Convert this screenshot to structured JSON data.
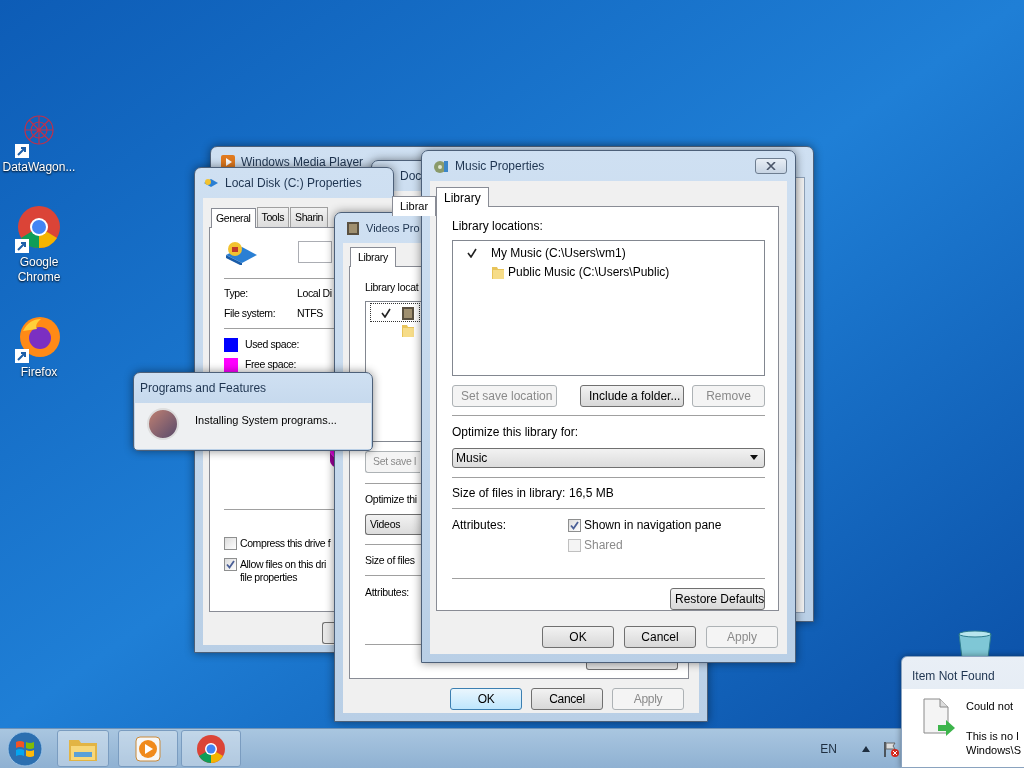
{
  "desktop_icons": [
    {
      "label": "DataWagon...",
      "kind": "datawagon"
    },
    {
      "label": "Google Chrome",
      "kind": "chrome"
    },
    {
      "label": "Firefox",
      "kind": "firefox"
    }
  ],
  "media_player_window": {
    "title": "Windows Media Player"
  },
  "documents_window": {
    "title": "Doc",
    "tabs": [
      {
        "label": "Librar",
        "selected": true
      }
    ]
  },
  "local_disk_window": {
    "title": "Local Disk (C:) Properties",
    "tabs": [
      {
        "label": "General",
        "selected": true
      },
      {
        "label": "Tools",
        "selected": false
      },
      {
        "label": "Sharin",
        "selected": false
      }
    ],
    "info": [
      {
        "label": "Type:",
        "value": "Local Di"
      },
      {
        "label": "File system:",
        "value": "NTFS"
      }
    ],
    "legend": [
      {
        "label": "Used space:",
        "color": "#0000ff"
      },
      {
        "label": "Free space:",
        "color": "#ff00ff"
      }
    ],
    "options": [
      {
        "lines": [
          "Compress this drive f"
        ],
        "checked": false
      },
      {
        "lines": [
          "Allow files on this dri",
          "file properties"
        ],
        "checked": true
      }
    ]
  },
  "programs_dialog": {
    "title": "Programs and Features",
    "message": "Installing System programs..."
  },
  "videos_window": {
    "title": "Videos Pro",
    "tabs": [
      {
        "label": "Library",
        "selected": true
      }
    ],
    "locations_label": "Library locat",
    "locations": [
      {
        "kind": "videos",
        "checked": true,
        "focused": true
      },
      {
        "kind": "folder",
        "checked": false,
        "focused": false
      }
    ],
    "set_save_button": {
      "label": "Set save l",
      "disabled": true
    },
    "optimize_label": "Optimize thi",
    "optimize_value": "Videos",
    "size_label": "Size of files",
    "attributes_label": "Attributes:",
    "buttons": [
      {
        "label": "OK",
        "default": true,
        "disabled": false
      },
      {
        "label": "Cancel",
        "default": false,
        "disabled": false
      },
      {
        "label": "Apply",
        "default": false,
        "disabled": true
      }
    ]
  },
  "music_window": {
    "title": "Music Properties",
    "tabs": [
      {
        "label": "Library",
        "selected": true
      }
    ],
    "locations_label": "Library locations:",
    "locations": [
      {
        "kind": "music",
        "name": "My Music (C:\\Users\\vm1)",
        "checked": true
      },
      {
        "kind": "folder",
        "name": "Public Music (C:\\Users\\Public)",
        "checked": false
      }
    ],
    "location_buttons": [
      {
        "label": "Set save location",
        "disabled": true
      },
      {
        "label": "Include a folder...",
        "disabled": false
      },
      {
        "label": "Remove",
        "disabled": true
      }
    ],
    "optimize_label": "Optimize this library for:",
    "optimize_value": "Music",
    "size_label": "Size of files in library:",
    "size_value": "16,5 MB",
    "attributes_label": "Attributes:",
    "attributes": [
      {
        "label": "Shown in navigation pane",
        "checked": true,
        "disabled": false
      },
      {
        "label": "Shared",
        "checked": false,
        "disabled": true
      }
    ],
    "restore_button": "Restore Defaults",
    "buttons": [
      {
        "label": "OK",
        "default": false,
        "disabled": false
      },
      {
        "label": "Cancel",
        "default": false,
        "disabled": false
      },
      {
        "label": "Apply",
        "default": false,
        "disabled": true
      }
    ]
  },
  "notification": {
    "title": "Item Not Found",
    "heading": "Could not",
    "message_lines": [
      "This is no l",
      "Windows\\S"
    ]
  },
  "taskbar": {
    "items": [
      {
        "kind": "start"
      },
      {
        "kind": "explorer"
      },
      {
        "kind": "media-player"
      },
      {
        "kind": "chrome"
      }
    ],
    "language": "EN"
  }
}
